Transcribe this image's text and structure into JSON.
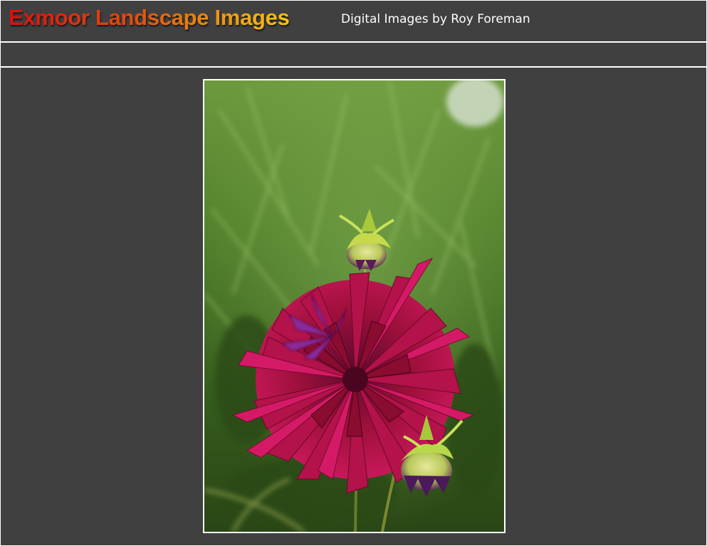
{
  "header": {
    "site_title": "Exmoor Landscape Images",
    "subtitle": "Digital Images by Roy Foreman"
  },
  "main": {
    "photo": {
      "subject": "dahlia-flower-photo"
    }
  },
  "colors": {
    "page_background": "#404040",
    "divider": "#ffffff",
    "title_gradient_start": "#d81010",
    "title_gradient_end": "#f7c21a",
    "subtitle_text": "#ffffff"
  }
}
